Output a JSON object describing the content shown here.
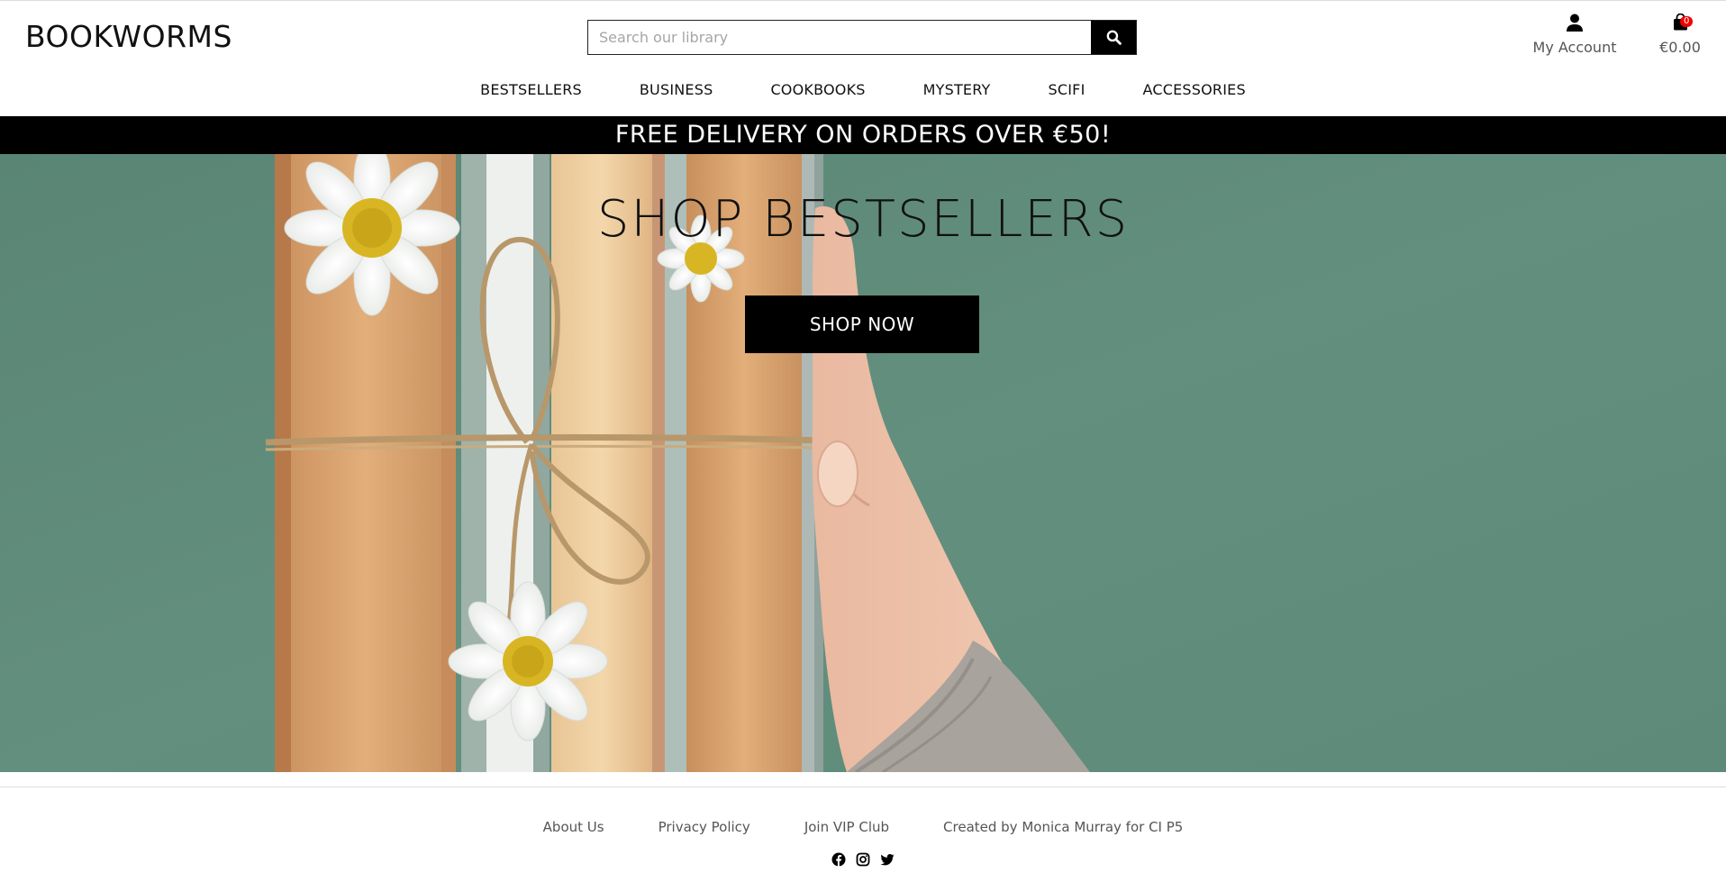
{
  "header": {
    "logo": "BOOKWORMS",
    "search": {
      "placeholder": "Search our library",
      "button_icon": "search-icon"
    },
    "account": {
      "icon": "user-icon",
      "label": "My Account"
    },
    "cart": {
      "icon": "shopping-bag-icon",
      "count": "0",
      "total": "€0.00"
    }
  },
  "nav": {
    "items": [
      "BESTSELLERS",
      "BUSINESS",
      "COOKBOOKS",
      "MYSTERY",
      "SCIFI",
      "ACCESSORIES"
    ]
  },
  "promo": {
    "text": "FREE DELIVERY ON ORDERS OVER €50!"
  },
  "hero": {
    "title": "SHOP BESTSELLERS",
    "button": "SHOP NOW"
  },
  "footer": {
    "links": [
      "About Us",
      "Privacy Policy",
      "Join VIP Club",
      "Created by Monica Murray for CI P5"
    ],
    "socials": [
      "facebook-icon",
      "instagram-icon",
      "twitter-icon"
    ]
  },
  "colors": {
    "brand": "#000000",
    "hero_background": "#5f8b7b",
    "badge": "#ee0000"
  }
}
